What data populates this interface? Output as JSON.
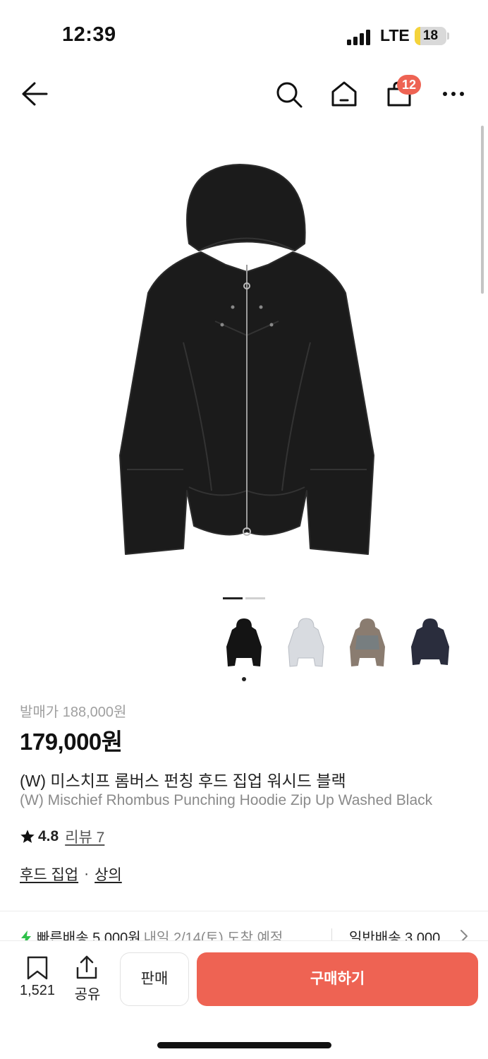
{
  "status_bar": {
    "time": "12:39",
    "network": "LTE",
    "battery": "18",
    "battery_level": 0.18
  },
  "header": {
    "cart_count": "12"
  },
  "gallery": {
    "active_index": 0,
    "page_count": 2
  },
  "thumbnails": [
    "black",
    "light-grey",
    "washed-brown",
    "navy"
  ],
  "product": {
    "release_price": "발매가 188,000원",
    "price": "179,000원",
    "title_ko": "(W) 미스치프 롬버스 펀칭 후드 집업 워시드 블랙",
    "title_en": "(W) Mischief Rhombus Punching Hoodie Zip Up Washed Black",
    "rating": "4.8",
    "review": "리뷰 7",
    "category_1": "후드 집업",
    "category_sep": "·",
    "category_2": "상의"
  },
  "shipping": {
    "fast": "빠른배송 5,000원",
    "fast_date": "내일 2/14(토) 도착 예정",
    "normal": "일반배송 3,000"
  },
  "bottom_bar": {
    "bookmark_count": "1,521",
    "share_label": "공유",
    "sell_label": "판매",
    "buy_label": "구매하기"
  },
  "colors": {
    "accent": "#ee6353",
    "muted": "#8a8a8a",
    "fast_ship": "#2ec14a"
  }
}
